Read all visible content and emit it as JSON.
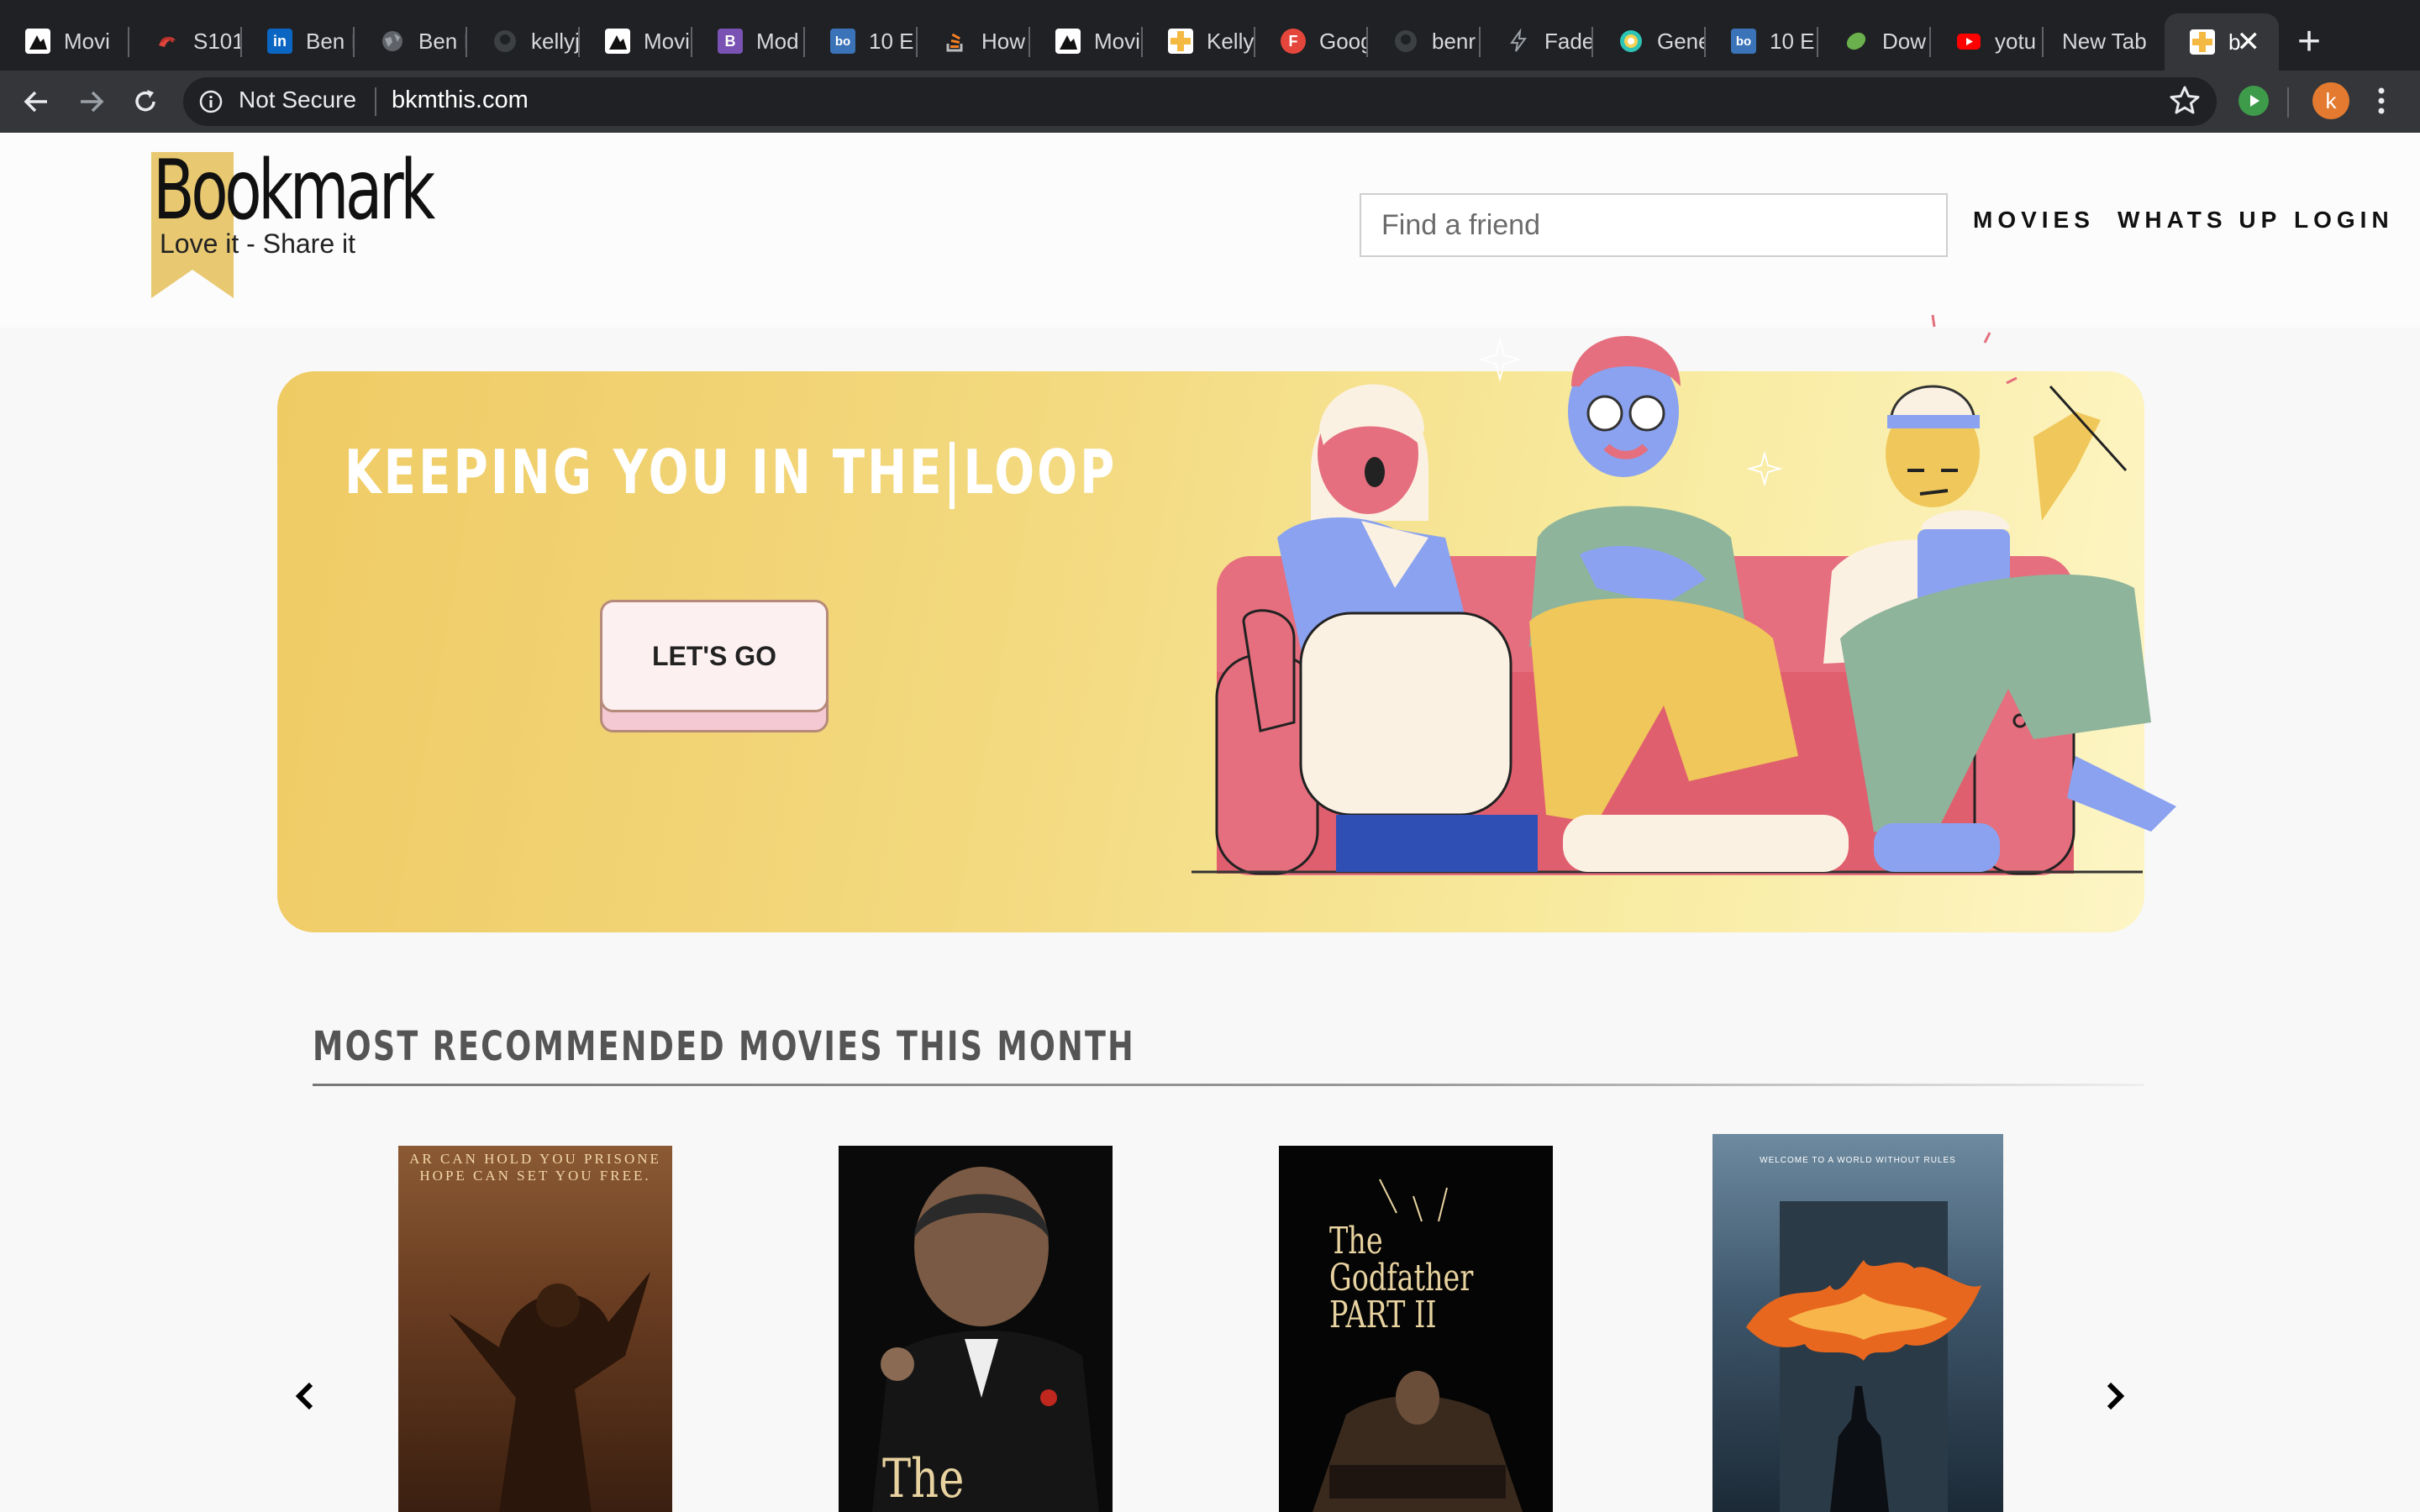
{
  "browser": {
    "tabs": [
      {
        "label": "Movi",
        "icon": "film-icon",
        "color": "#ffffff"
      },
      {
        "label": "S101",
        "icon": "swirl-icon",
        "color": "#e0443a"
      },
      {
        "label": "Ben I",
        "icon": "linkedin-icon",
        "color": "#0a66c2"
      },
      {
        "label": "Ben I",
        "icon": "globe-icon",
        "color": "#9aa0a6"
      },
      {
        "label": "kellyj",
        "icon": "github-icon",
        "color": "#5f6368"
      },
      {
        "label": "Movi",
        "icon": "film-icon",
        "color": "#ffffff"
      },
      {
        "label": "Mod",
        "icon": "bootstrap-icon",
        "color": "#7952b3"
      },
      {
        "label": "10 E",
        "icon": "bo-icon",
        "color": "#3b73b9"
      },
      {
        "label": "How",
        "icon": "stackoverflow-icon",
        "color": "#f48024"
      },
      {
        "label": "Movi",
        "icon": "film-icon",
        "color": "#ffffff"
      },
      {
        "label": "Kelly",
        "icon": "cross-icon",
        "color": "#f4b942"
      },
      {
        "label": "Goog",
        "icon": "f-icon",
        "color": "#e5463c"
      },
      {
        "label": "benr",
        "icon": "github-icon",
        "color": "#5f6368"
      },
      {
        "label": "Fade",
        "icon": "bolt-icon",
        "color": "#5f6368"
      },
      {
        "label": "Gene",
        "icon": "circle-icon",
        "color": "#2ec4b6"
      },
      {
        "label": "10 E",
        "icon": "bo-icon",
        "color": "#3b73b9"
      },
      {
        "label": "Dow",
        "icon": "leaf-icon",
        "color": "#6ab04c"
      },
      {
        "label": "yotu",
        "icon": "youtube-icon",
        "color": "#ff0000"
      },
      {
        "label": "New Tab",
        "icon": "",
        "color": ""
      },
      {
        "label": "b",
        "icon": "cross-icon",
        "color": "#f4b942",
        "active": true
      }
    ],
    "not_secure_label": "Not Secure",
    "url": "bkmthis.com",
    "profile_initial": "k"
  },
  "site": {
    "logo_title": "Bookmark",
    "logo_tagline": "Love it - Share it",
    "search_placeholder": "Find a friend",
    "nav": [
      "MOVIES",
      "WHATS UP",
      "LOGIN"
    ]
  },
  "hero": {
    "title": "KEEPING YOU IN THE LOOP",
    "cta_label": "LET'S GO"
  },
  "section": {
    "title": "MOST RECOMMENDED MOVIES THIS MONTH",
    "posters": [
      {
        "name": "shawshank-poster",
        "text": "AR CAN HOLD YOU PRISONE HOPE CAN SET YOU FREE."
      },
      {
        "name": "godfather-poster",
        "text": "The"
      },
      {
        "name": "godfather-2-poster",
        "text": "The Godfather PART II"
      },
      {
        "name": "dark-knight-poster",
        "text": "WELCOME TO A WORLD WITHOUT RULES"
      }
    ]
  },
  "colors": {
    "brand_yellow": "#f1cf6a",
    "chrome_dark": "#202124",
    "chrome_toolbar": "#35363a"
  }
}
